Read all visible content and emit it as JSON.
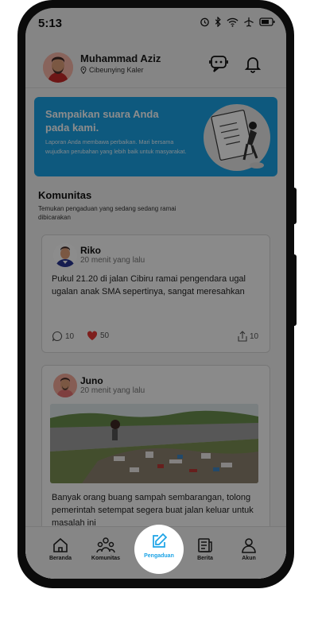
{
  "status": {
    "time": "5:13"
  },
  "user": {
    "name": "Muhammad Aziz",
    "location": "Cibeunying Kaler"
  },
  "banner": {
    "title": "Sampaikan suara Anda pada kami.",
    "text": "Laporan Anda membawa perbaikan. Mari bersama wujudkan perubahan yang lebih baik untuk masyarakat."
  },
  "community": {
    "title": "Komunitas",
    "subtitle": "Temukan pengaduan yang sedang sedang ramai dibicarakan"
  },
  "posts": [
    {
      "name": "Riko",
      "time": "20 menit yang lalu",
      "text": "Pukul 21.20 di jalan Cibiru ramai pengendara ugal ugalan anak SMA sepertinya, sangat meresahkan",
      "comments": "10",
      "likes": "50",
      "shares": "10"
    },
    {
      "name": "Juno",
      "time": "20 menit yang lalu",
      "text": "Banyak orang buang sampah sembarangan, tolong pemerintah setempat segera buat jalan keluar untuk masalah ini"
    }
  ],
  "nav": {
    "items": [
      "Beranda",
      "Komunitas",
      "Pengaduan",
      "Berita",
      "Akun"
    ],
    "active": "Pengaduan"
  },
  "colors": {
    "accent": "#1ba3e6",
    "like": "#e53935"
  }
}
